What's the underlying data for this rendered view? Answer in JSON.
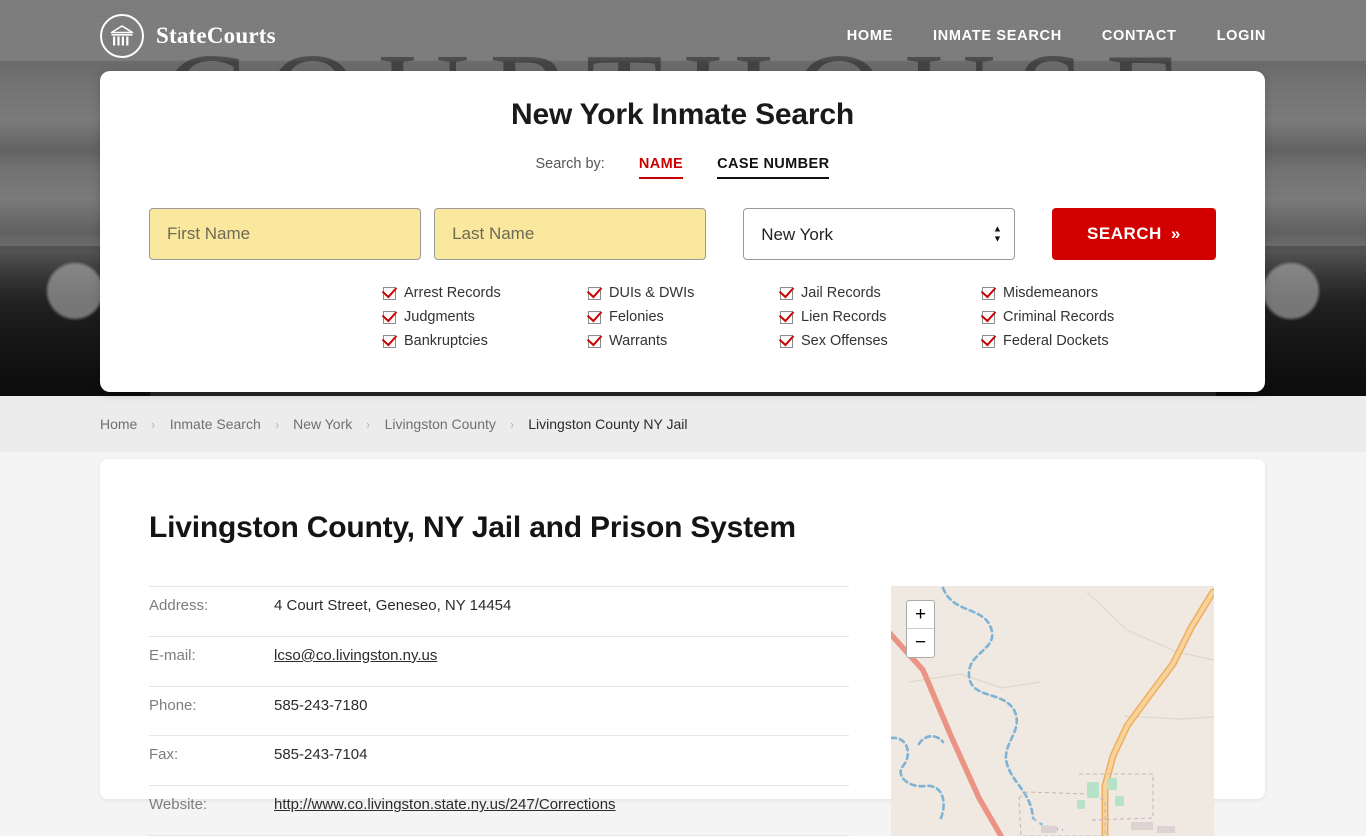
{
  "header": {
    "brand_name": "StateCourts",
    "brand_icon": "courthouse-circle-icon",
    "background_word": "COURTHOUSE",
    "nav": [
      {
        "label": "HOME"
      },
      {
        "label": "INMATE SEARCH"
      },
      {
        "label": "CONTACT"
      },
      {
        "label": "LOGIN"
      }
    ]
  },
  "search": {
    "title": "New York Inmate Search",
    "search_by_label": "Search by:",
    "tabs": [
      {
        "label": "NAME",
        "active": true
      },
      {
        "label": "CASE NUMBER",
        "active": false
      }
    ],
    "first_name_placeholder": "First Name",
    "first_name_value": "",
    "last_name_placeholder": "Last Name",
    "last_name_value": "",
    "state_value": "New York",
    "state_options": [
      "New York"
    ],
    "submit_label": "SEARCH",
    "submit_chevrons": "»",
    "accent_red": "#cc0000",
    "button_red": "#d30000",
    "field_yellow": "#fae89f",
    "record_types": [
      "Arrest Records",
      "DUIs & DWIs",
      "Jail Records",
      "Misdemeanors",
      "Judgments",
      "Felonies",
      "Lien Records",
      "Criminal Records",
      "Bankruptcies",
      "Warrants",
      "Sex Offenses",
      "Federal Dockets"
    ]
  },
  "breadcrumb": {
    "separator": "›",
    "items": [
      {
        "label": "Home",
        "current": false
      },
      {
        "label": "Inmate Search",
        "current": false
      },
      {
        "label": "New York",
        "current": false
      },
      {
        "label": "Livingston County",
        "current": false
      },
      {
        "label": "Livingston County NY Jail",
        "current": true
      }
    ]
  },
  "page": {
    "title": "Livingston County, NY Jail and Prison System",
    "info_rows": [
      {
        "key": "Address:",
        "value": "4 Court Street, Geneseo, NY 14454",
        "link": false
      },
      {
        "key": "E-mail:",
        "value": "lcso@co.livingston.ny.us",
        "link": true
      },
      {
        "key": "Phone:",
        "value": "585-243-7180",
        "link": false
      },
      {
        "key": "Fax:",
        "value": "585-243-7104",
        "link": false
      },
      {
        "key": "Website:",
        "value": "http://www.co.livingston.state.ny.us/247/Corrections",
        "link": true
      }
    ]
  },
  "map": {
    "zoom_in_label": "+",
    "zoom_out_label": "−",
    "land_color": "#efe9e2",
    "major_road_color": "#f2b06a",
    "minor_road_color": "#e8917f",
    "water_color": "#7fb3d5"
  }
}
